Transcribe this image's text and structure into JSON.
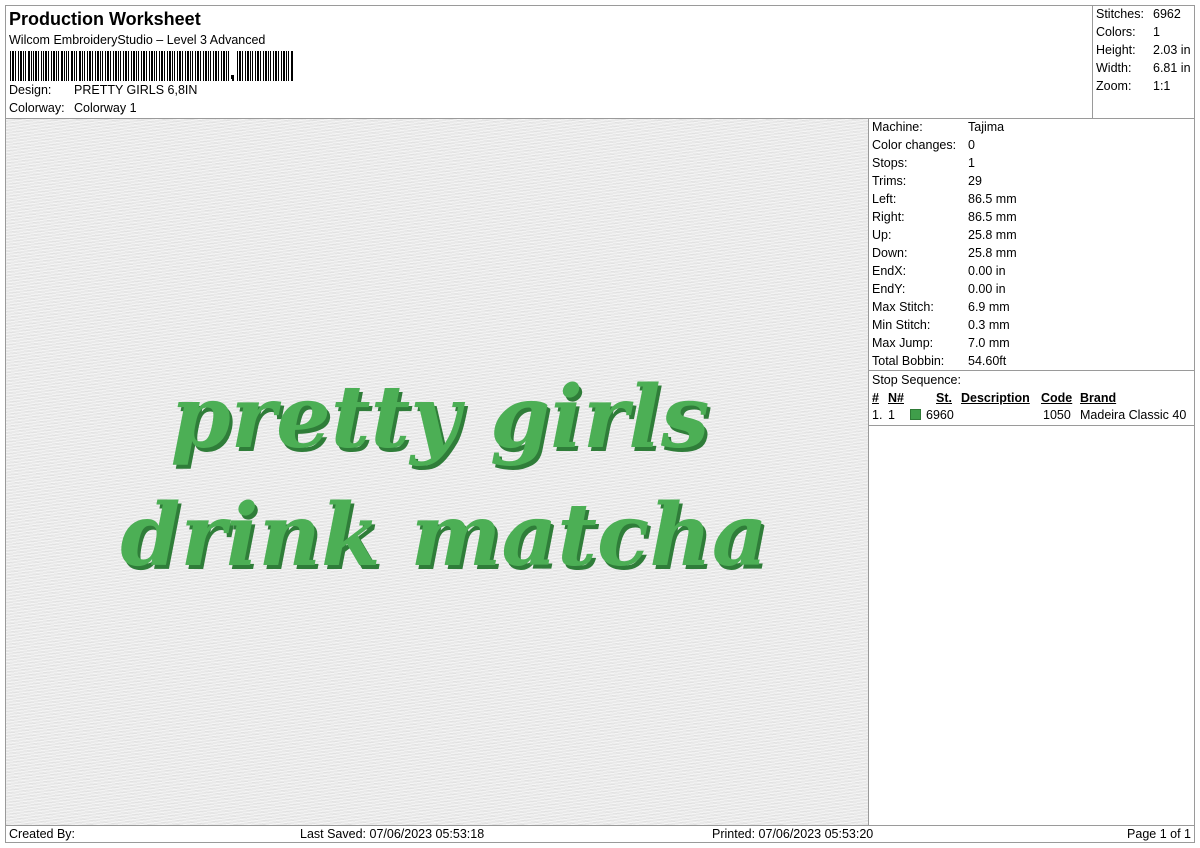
{
  "header": {
    "title": "Production Worksheet",
    "subtitle": "Wilcom EmbroideryStudio – Level 3 Advanced",
    "design_label": "Design:",
    "design_value": "PRETTY GIRLS 6,8IN",
    "colorway_label": "Colorway:",
    "colorway_value": "Colorway 1"
  },
  "summary": {
    "stitches_label": "Stitches:",
    "stitches_value": "6962",
    "colors_label": "Colors:",
    "colors_value": "1",
    "height_label": "Height:",
    "height_value": "2.03 in",
    "width_label": "Width:",
    "width_value": "6.81 in",
    "zoom_label": "Zoom:",
    "zoom_value": "1:1"
  },
  "design_text": {
    "line1": "pretty girls",
    "line2": "drink matcha",
    "thread_color": "#4caf55",
    "shadow_color": "#2f7d39"
  },
  "details": [
    {
      "label": "Machine:",
      "value": "Tajima"
    },
    {
      "label": "Color changes:",
      "value": "0"
    },
    {
      "label": "Stops:",
      "value": "1"
    },
    {
      "label": "Trims:",
      "value": "29"
    },
    {
      "label": "Left:",
      "value": "86.5 mm"
    },
    {
      "label": "Right:",
      "value": "86.5 mm"
    },
    {
      "label": "Up:",
      "value": "25.8 mm"
    },
    {
      "label": "Down:",
      "value": "25.8 mm"
    },
    {
      "label": "EndX:",
      "value": "0.00 in"
    },
    {
      "label": "EndY:",
      "value": "0.00 in"
    },
    {
      "label": "Max Stitch:",
      "value": "6.9 mm"
    },
    {
      "label": "Min Stitch:",
      "value": "0.3 mm"
    },
    {
      "label": "Max Jump:",
      "value": "7.0 mm"
    },
    {
      "label": "Total Bobbin:",
      "value": "54.60ft"
    }
  ],
  "stop_sequence": {
    "title": "Stop Sequence:",
    "headers": [
      "#",
      "N#",
      "St.",
      "Description",
      "Code",
      "Brand"
    ],
    "rows": [
      {
        "num": "1.",
        "n": "1",
        "color": "#3f9e4a",
        "st": "6960",
        "description": "",
        "code": "1050",
        "brand": "Madeira Classic 40"
      }
    ]
  },
  "footer": {
    "created_by": "Created By:",
    "last_saved": "Last Saved: 07/06/2023 05:53:18",
    "printed": "Printed: 07/06/2023 05:53:20",
    "page": "Page 1 of 1"
  }
}
